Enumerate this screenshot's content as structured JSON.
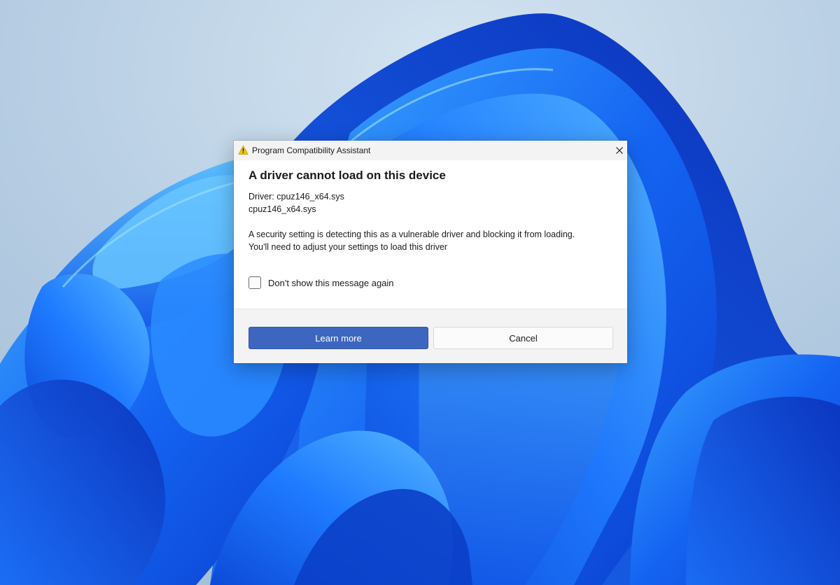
{
  "window": {
    "title": "Program Compatibility Assistant",
    "icon": "warning-icon",
    "close_icon": "close-icon"
  },
  "dialog": {
    "heading": "A driver cannot load on this device",
    "driver_line": "Driver: cpuz146_x64.sys",
    "driver_file": "cpuz146_x64.sys",
    "message_line1": "A security setting is detecting this as a vulnerable driver and blocking it from loading.",
    "message_line2": "You'll need to adjust your settings to load this driver",
    "checkbox_label": "Don't show this message again",
    "checkbox_checked": false
  },
  "buttons": {
    "learn_more": "Learn more",
    "cancel": "Cancel"
  },
  "colors": {
    "accent": "#3d66c0",
    "warning": "#f2c200"
  }
}
